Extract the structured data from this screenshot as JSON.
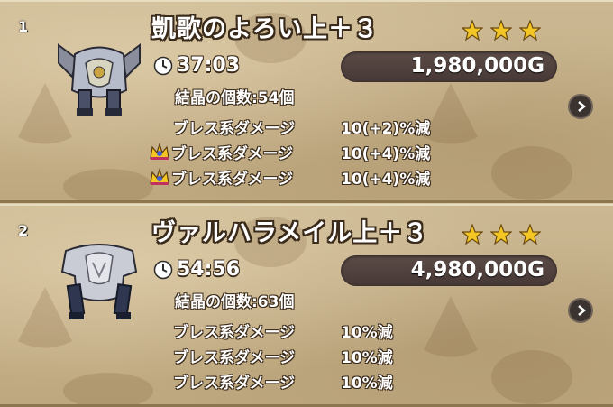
{
  "items": [
    {
      "rank": "1",
      "name": "凱歌のよろい上＋３",
      "stars": 3,
      "time_left": "37:03",
      "price": "1,980,000G",
      "crystal_label": "結晶の個数:54個",
      "effects": [
        {
          "name": "ブレス系ダメージ",
          "value": "10(+2)%減",
          "crown": false
        },
        {
          "name": "ブレス系ダメージ",
          "value": "10(+4)%減",
          "crown": true
        },
        {
          "name": "ブレス系ダメージ",
          "value": "10(+4)%減",
          "crown": true
        }
      ]
    },
    {
      "rank": "2",
      "name": "ヴァルハラメイル上＋３",
      "stars": 3,
      "time_left": "54:56",
      "price": "4,980,000G",
      "crystal_label": "結晶の個数:63個",
      "effects": [
        {
          "name": "ブレス系ダメージ",
          "value": "10%減",
          "crown": false
        },
        {
          "name": "ブレス系ダメージ",
          "value": "10%減",
          "crown": false
        },
        {
          "name": "ブレス系ダメージ",
          "value": "10%減",
          "crown": false
        }
      ]
    }
  ],
  "colors": {
    "star": "#f3c623",
    "panel": "#c7b38b",
    "price_box": "#4f403d"
  },
  "icons": [
    "clock-icon",
    "star-icon",
    "crown-icon",
    "chevron-right-icon",
    "armor-icon"
  ]
}
